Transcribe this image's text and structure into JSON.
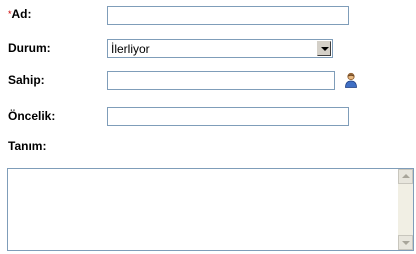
{
  "form": {
    "name": {
      "required_mark": "*",
      "label": "Ad:",
      "value": ""
    },
    "status": {
      "label": "Durum:",
      "selected": "İlerliyor"
    },
    "owner": {
      "label": "Sahip:",
      "value": "",
      "icon": "user-picker-icon"
    },
    "priority": {
      "label": "Öncelik:",
      "value": ""
    },
    "description": {
      "label": "Tanım:",
      "value": ""
    }
  },
  "colors": {
    "required": "#cc0000",
    "field_border": "#7f9db9"
  }
}
